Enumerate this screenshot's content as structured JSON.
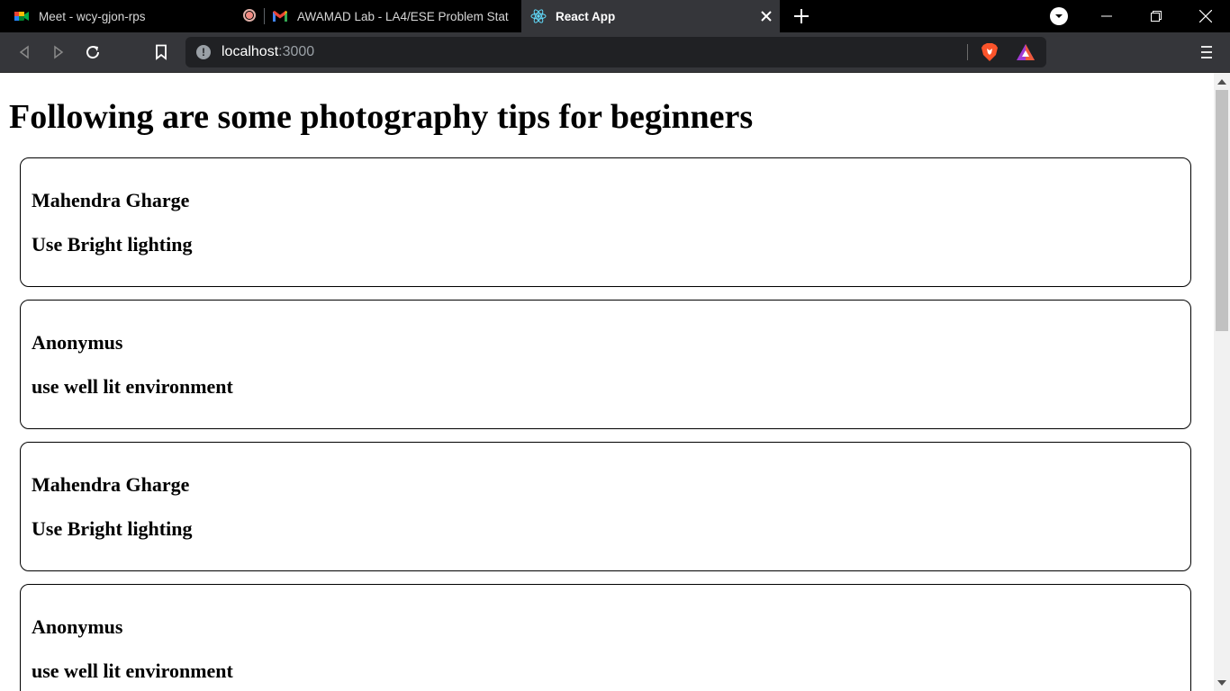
{
  "browser": {
    "tabs": [
      {
        "title": "Meet - wcy-gjon-rps",
        "icon": "google-meet-icon",
        "recording": true
      },
      {
        "title": "AWAMAD Lab - LA4/ESE Problem Stat",
        "icon": "gmail-icon"
      },
      {
        "title": "React App",
        "icon": "react-icon",
        "active": true
      }
    ],
    "address": {
      "host": "localhost",
      "port": ":3000"
    }
  },
  "page": {
    "heading": "Following are some photography tips for beginners",
    "tips": [
      {
        "author": "Mahendra Gharge",
        "tip": "Use Bright lighting"
      },
      {
        "author": "Anonymus",
        "tip": "use well lit environment"
      },
      {
        "author": "Mahendra Gharge",
        "tip": "Use Bright lighting"
      },
      {
        "author": "Anonymus",
        "tip": "use well lit environment"
      }
    ]
  },
  "colors": {
    "tabstrip": "#000000",
    "toolbar": "#35363a",
    "omnibox": "#202124",
    "brave": "#fb542b",
    "react": "#61dafb"
  }
}
